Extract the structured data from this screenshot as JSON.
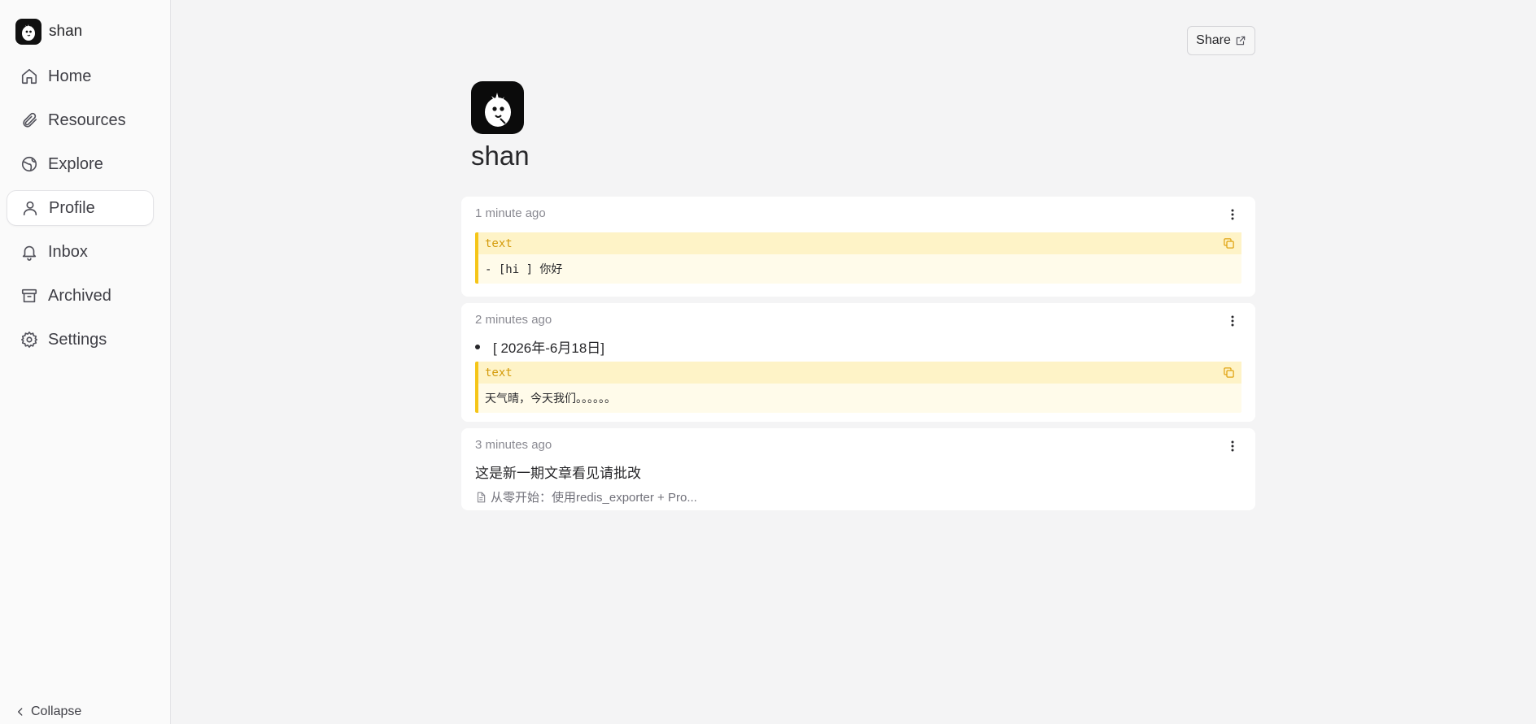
{
  "sidebar": {
    "user_name": "shan",
    "items": [
      {
        "label": "Home",
        "icon": "home-icon"
      },
      {
        "label": "Resources",
        "icon": "paperclip-icon"
      },
      {
        "label": "Explore",
        "icon": "globe-icon"
      },
      {
        "label": "Profile",
        "icon": "user-icon",
        "active": true
      },
      {
        "label": "Inbox",
        "icon": "bell-icon"
      },
      {
        "label": "Archived",
        "icon": "archive-icon"
      },
      {
        "label": "Settings",
        "icon": "gear-icon"
      }
    ],
    "collapse_label": "Collapse"
  },
  "header": {
    "share_label": "Share"
  },
  "profile": {
    "name": "shan"
  },
  "memos": [
    {
      "time": "1 minute ago",
      "code_lang": "text",
      "code_text": "- [hi ] 你好"
    },
    {
      "time": "2 minutes ago",
      "bullet": "[ 2026年-6月18日]",
      "code_lang": "text",
      "code_text": "天气晴，今天我们。。。。。。"
    },
    {
      "time": "3 minutes ago",
      "text": "这是新一期文章看见请批改",
      "attachment": "从零开始：使用redis_exporter + Pro..."
    }
  ],
  "colors": {
    "accent": "#f5c518",
    "code_header_bg": "#fef3c7",
    "code_body_bg": "#fffbea",
    "background": "#f4f4f5"
  }
}
